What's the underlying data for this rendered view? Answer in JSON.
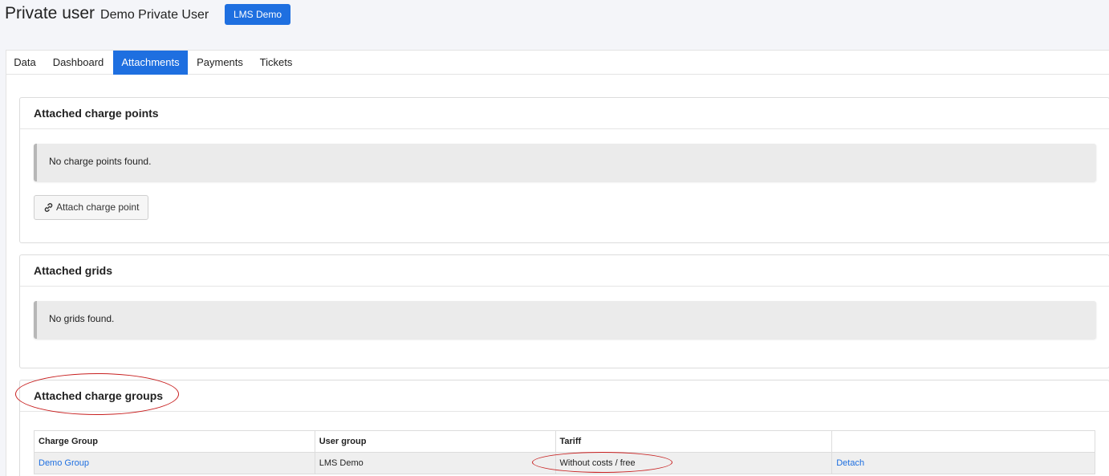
{
  "header": {
    "kind": "Private user",
    "name": "Demo Private User",
    "badge": "LMS Demo"
  },
  "tabs": [
    {
      "label": "Data",
      "active": false
    },
    {
      "label": "Dashboard",
      "active": false
    },
    {
      "label": "Attachments",
      "active": true
    },
    {
      "label": "Payments",
      "active": false
    },
    {
      "label": "Tickets",
      "active": false
    }
  ],
  "charge_points": {
    "title": "Attached charge points",
    "empty_text": "No charge points found.",
    "attach_button": "Attach charge point",
    "attach_icon": "link-icon"
  },
  "grids": {
    "title": "Attached grids",
    "empty_text": "No grids found."
  },
  "charge_groups": {
    "title": "Attached charge groups",
    "columns": [
      "Charge Group",
      "User group",
      "Tariff",
      ""
    ],
    "rows": [
      {
        "charge_group": "Demo Group",
        "user_group": "LMS Demo",
        "tariff": "Without costs / free",
        "action": "Detach"
      }
    ]
  },
  "colors": {
    "accent": "#1e6fe0",
    "annotation": "#c82020"
  }
}
